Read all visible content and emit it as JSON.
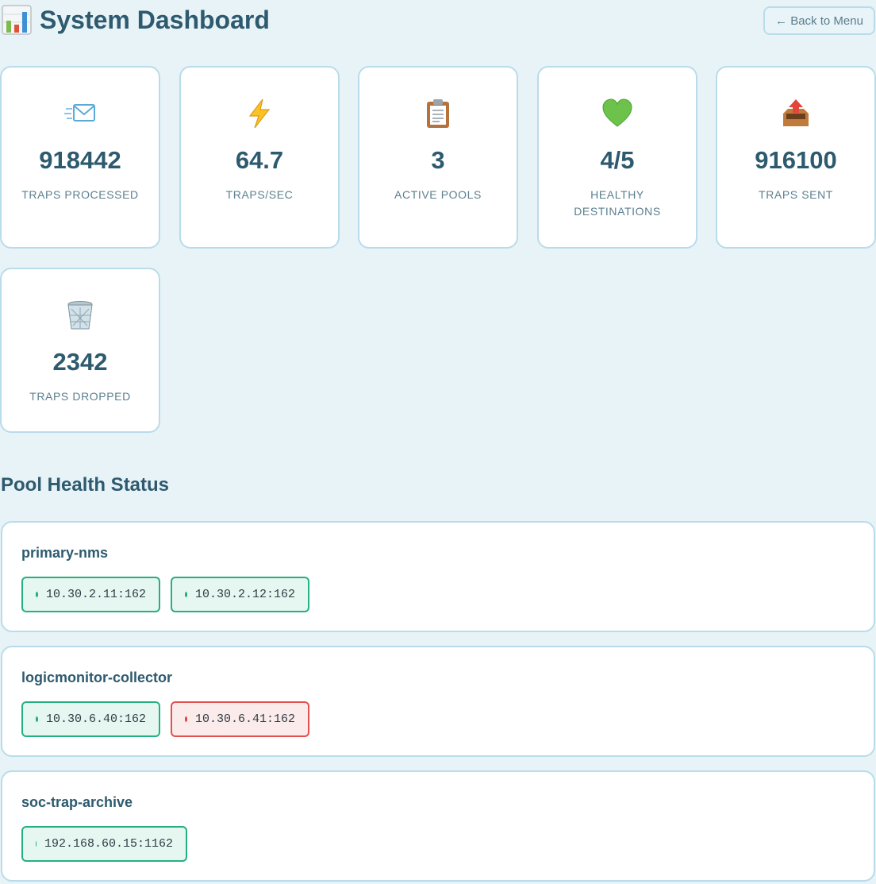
{
  "header": {
    "icon": "bar-chart-icon",
    "title": "System Dashboard",
    "back_label": "← Back to Menu"
  },
  "stats": [
    {
      "icon": "envelope-icon",
      "value": "918442",
      "label": "Traps Processed"
    },
    {
      "icon": "lightning-icon",
      "value": "64.7",
      "label": "Traps/sec"
    },
    {
      "icon": "clipboard-icon",
      "value": "3",
      "label": "Active Pools"
    },
    {
      "icon": "green-heart-icon",
      "value": "4/5",
      "label": "Healthy Destinations"
    },
    {
      "icon": "outbox-tray-icon",
      "value": "916100",
      "label": "Traps Sent"
    },
    {
      "icon": "wastebasket-icon",
      "value": "2342",
      "label": "Traps Dropped"
    }
  ],
  "pool_section": {
    "title": "Pool Health Status",
    "pools": [
      {
        "name": "primary-nms",
        "destinations": [
          {
            "address": "10.30.2.11:162",
            "status": "healthy"
          },
          {
            "address": "10.30.2.12:162",
            "status": "healthy"
          }
        ]
      },
      {
        "name": "logicmonitor-collector",
        "destinations": [
          {
            "address": "10.30.6.40:162",
            "status": "healthy"
          },
          {
            "address": "10.30.6.41:162",
            "status": "unhealthy"
          }
        ]
      },
      {
        "name": "soc-trap-archive",
        "destinations": [
          {
            "address": "192.168.60.15:1162",
            "status": "healthy"
          }
        ]
      }
    ]
  },
  "colors": {
    "background": "#e8f3f8",
    "text": "#2d5a6e",
    "healthy": "#25b082",
    "unhealthy": "#e25050"
  }
}
